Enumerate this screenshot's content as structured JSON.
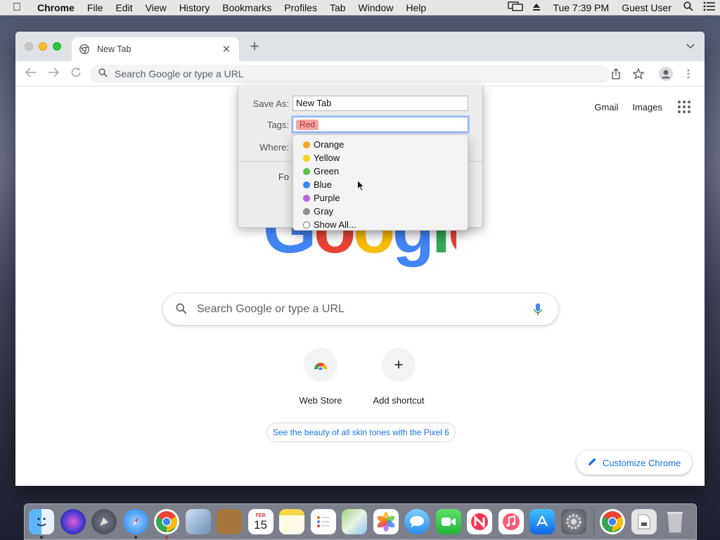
{
  "menubar": {
    "app_name": "Chrome",
    "items": [
      "File",
      "Edit",
      "View",
      "History",
      "Bookmarks",
      "Profiles",
      "Tab",
      "Window",
      "Help"
    ],
    "clock": "Tue 7:39 PM",
    "user": "Guest User"
  },
  "browser": {
    "tab_title": "New Tab",
    "omnibox_placeholder": "Search Google or type a URL"
  },
  "ntp": {
    "gmail": "Gmail",
    "images": "Images",
    "logo": "Google",
    "search_placeholder": "Search Google or type a URL",
    "shortcuts": [
      {
        "label": "Web Store"
      },
      {
        "label": "Add shortcut"
      }
    ],
    "promo": "See the beauty of all skin tones with the Pixel 6",
    "customize": "Customize Chrome"
  },
  "save_dialog": {
    "save_as_label": "Save As:",
    "save_as_value": "New Tab",
    "tags_label": "Tags:",
    "tag_value": "Red",
    "where_label": "Where:",
    "partial_label": "Fo",
    "tag_options": [
      {
        "label": "Orange",
        "color": "#f5a623"
      },
      {
        "label": "Yellow",
        "color": "#f8d11f"
      },
      {
        "label": "Green",
        "color": "#5cc54a"
      },
      {
        "label": "Blue",
        "color": "#3b87f5"
      },
      {
        "label": "Purple",
        "color": "#b565e0"
      },
      {
        "label": "Gray",
        "color": "#8e8e8e"
      },
      {
        "label": "Show All...",
        "color": "none"
      }
    ]
  },
  "dock": {
    "apps": [
      "Finder",
      "Siri",
      "Launchpad",
      "Safari",
      "Chrome",
      "Preview",
      "Contacts",
      "Calendar",
      "Notes",
      "Reminders",
      "Maps",
      "Photos",
      "Messages",
      "FaceTime",
      "News",
      "Music",
      "App Store",
      "System Preferences",
      "Chrome",
      "Downloads",
      "Trash"
    ],
    "calendar_day": "15",
    "calendar_month": "FEB"
  }
}
